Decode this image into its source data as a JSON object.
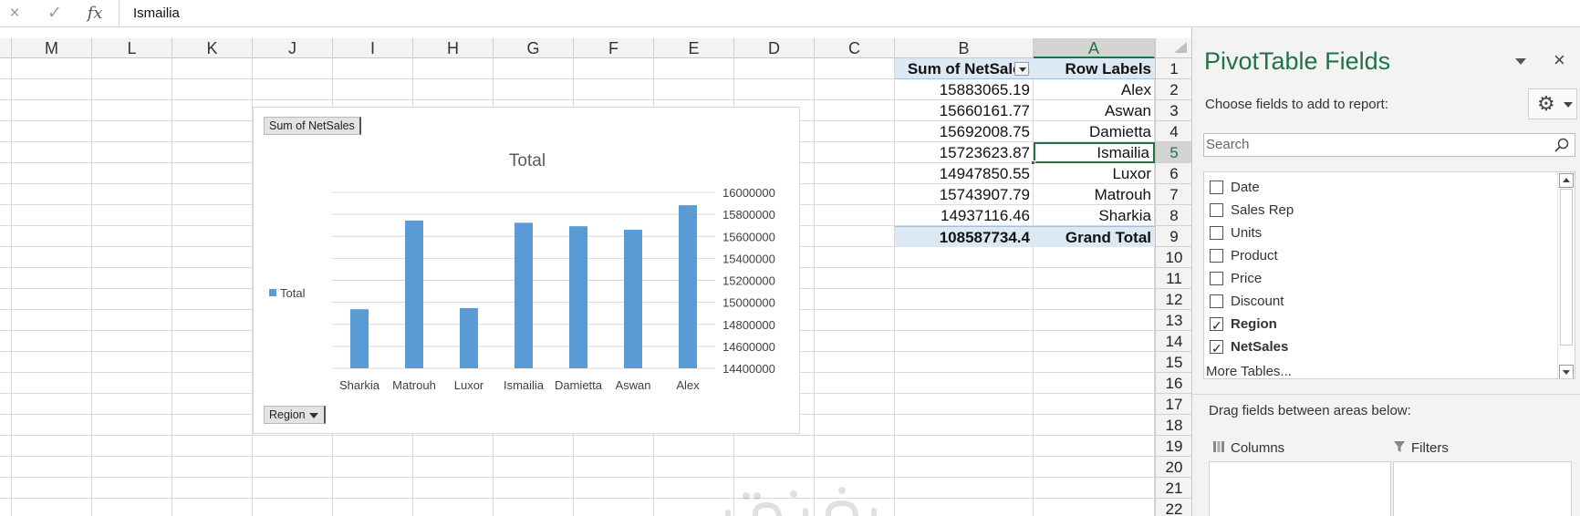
{
  "formula_bar": {
    "cancel_icon": "×",
    "enter_icon": "✓",
    "fx_label": "fx",
    "value": "Ismailia"
  },
  "grid": {
    "columns": [
      "M",
      "L",
      "K",
      "J",
      "I",
      "H",
      "G",
      "F",
      "E",
      "D",
      "C",
      "B",
      "A"
    ],
    "active_column": "A",
    "rows": [
      "1",
      "2",
      "3",
      "4",
      "5",
      "6",
      "7",
      "8",
      "9",
      "10",
      "11",
      "12",
      "13",
      "14",
      "15",
      "16",
      "17",
      "18",
      "19",
      "20",
      "21",
      "22"
    ],
    "active_row": "5"
  },
  "pivot": {
    "header_values": "Sum of NetSales",
    "header_labels": "Row Labels",
    "rows": [
      {
        "label": "Alex",
        "value": "15883065.19"
      },
      {
        "label": "Aswan",
        "value": "15660161.77"
      },
      {
        "label": "Damietta",
        "value": "15692008.75"
      },
      {
        "label": "Ismailia",
        "value": "15723623.87"
      },
      {
        "label": "Luxor",
        "value": "14947850.55"
      },
      {
        "label": "Matrouh",
        "value": "15743907.79"
      },
      {
        "label": "Sharkia",
        "value": "14937116.46"
      }
    ],
    "total_value": "108587734.4",
    "total_label": "Grand Total"
  },
  "chart": {
    "field_button_values": "Sum of NetSales",
    "field_button_axis": "Region",
    "legend_label": "Total"
  },
  "chart_data": {
    "type": "bar",
    "title": "Total",
    "categories": [
      "Sharkia",
      "Matrouh",
      "Luxor",
      "Ismailia",
      "Damietta",
      "Aswan",
      "Alex"
    ],
    "series": [
      {
        "name": "Total",
        "values": [
          14937116.46,
          15743907.79,
          14947850.55,
          15723623.87,
          15692008.75,
          15660161.77,
          15883065.19
        ],
        "color": "#5b9bd5"
      }
    ],
    "ylim": [
      14400000,
      16000000
    ],
    "yticks": [
      "16000000",
      "15800000",
      "15600000",
      "15400000",
      "15200000",
      "15000000",
      "14800000",
      "14600000",
      "14400000"
    ],
    "y_axis_side": "right",
    "grid": true,
    "legend_position": "left"
  },
  "pane": {
    "title": "PivotTable Fields",
    "close_icon": "×",
    "subtitle": "Choose fields to add to report:",
    "gear_icon": "⚙",
    "search_placeholder": "Search",
    "fields": [
      {
        "label": "Date",
        "checked": false
      },
      {
        "label": "Sales Rep",
        "checked": false
      },
      {
        "label": "Units",
        "checked": false
      },
      {
        "label": "Product",
        "checked": false
      },
      {
        "label": "Price",
        "checked": false
      },
      {
        "label": "Discount",
        "checked": false
      },
      {
        "label": "Region",
        "checked": true
      },
      {
        "label": "NetSales",
        "checked": true
      }
    ],
    "more_tables": "More Tables...",
    "drag_text": "Drag fields between areas below:",
    "areas": {
      "columns": "Columns",
      "filters": "Filters"
    }
  },
  "colors": {
    "accent": "#217346",
    "bar": "#5b9bd5",
    "pivot_header_bg": "#dde8f5"
  }
}
